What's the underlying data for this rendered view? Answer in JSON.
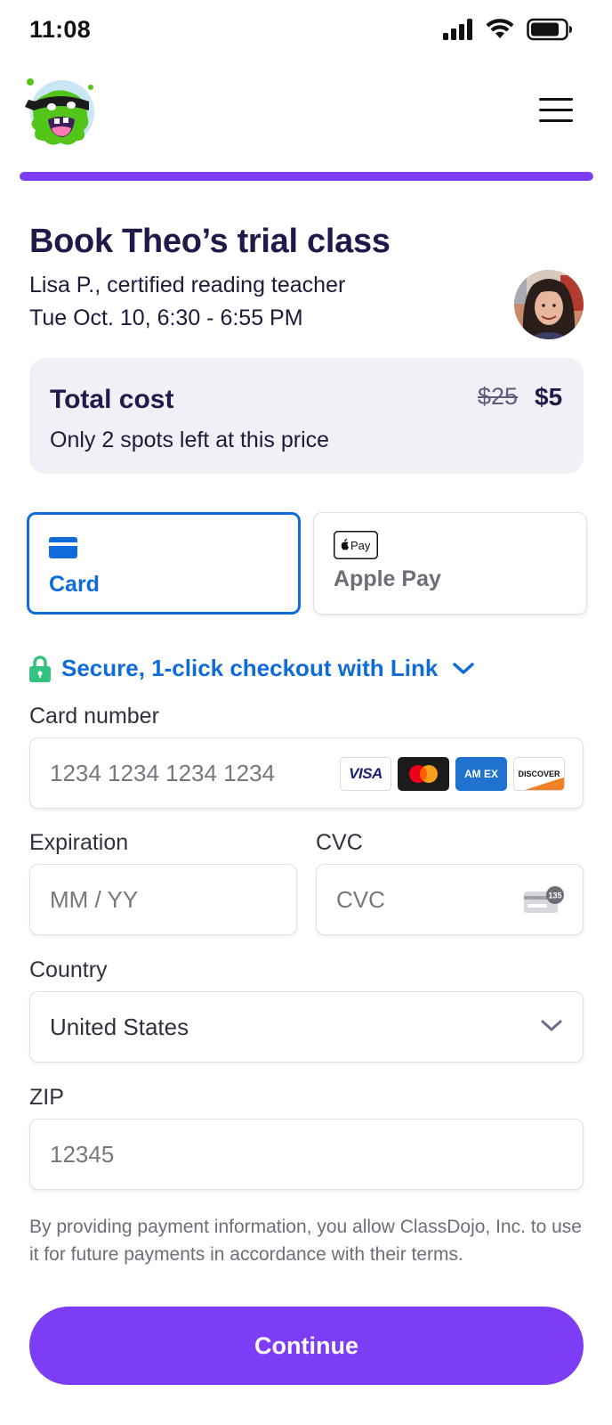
{
  "status_bar": {
    "time": "11:08",
    "icons": [
      "signal-icon",
      "wifi-icon",
      "battery-icon"
    ]
  },
  "header": {
    "logo": "classdojo-monster-logo",
    "menu_icon": "hamburger-menu-icon"
  },
  "progress": {
    "fraction": 1.0,
    "color": "#7d3cf5"
  },
  "booking": {
    "title": "Book Theo’s trial class",
    "teacher": "Lisa P., certified reading teacher",
    "datetime": "Tue Oct. 10, 6:30 - 6:55 PM"
  },
  "cost": {
    "label": "Total cost",
    "original_price": "$25",
    "price": "$5",
    "note": "Only 2 spots left at this price"
  },
  "payment_tabs": [
    {
      "label": "Card",
      "icon": "credit-card-icon",
      "selected": true
    },
    {
      "label": "Apple Pay",
      "icon": "apple-pay-icon",
      "badge": "Pay",
      "selected": false
    }
  ],
  "link": {
    "text": "Secure, 1-click checkout with Link",
    "icon": "lock-icon"
  },
  "form": {
    "card_number": {
      "label": "Card number",
      "placeholder": "1234 1234 1234 1234"
    },
    "card_brands": {
      "visa": "VISA",
      "amex": "AM EX",
      "discover": "DISCOVER"
    },
    "expiration": {
      "label": "Expiration",
      "placeholder": "MM / YY"
    },
    "cvc": {
      "label": "CVC",
      "placeholder": "CVC",
      "icon_text": "135"
    },
    "country": {
      "label": "Country",
      "value": "United States"
    },
    "zip": {
      "label": "ZIP",
      "placeholder": "12345"
    }
  },
  "disclaimer": "By providing payment information, you allow ClassDojo, Inc. to use it for future payments in accordance with their terms.",
  "continue_label": "Continue",
  "colors": {
    "accent_purple": "#7d3cf5",
    "link_blue": "#0f6bd9",
    "lock_green": "#33c27f",
    "title_navy": "#1e1b4b"
  }
}
